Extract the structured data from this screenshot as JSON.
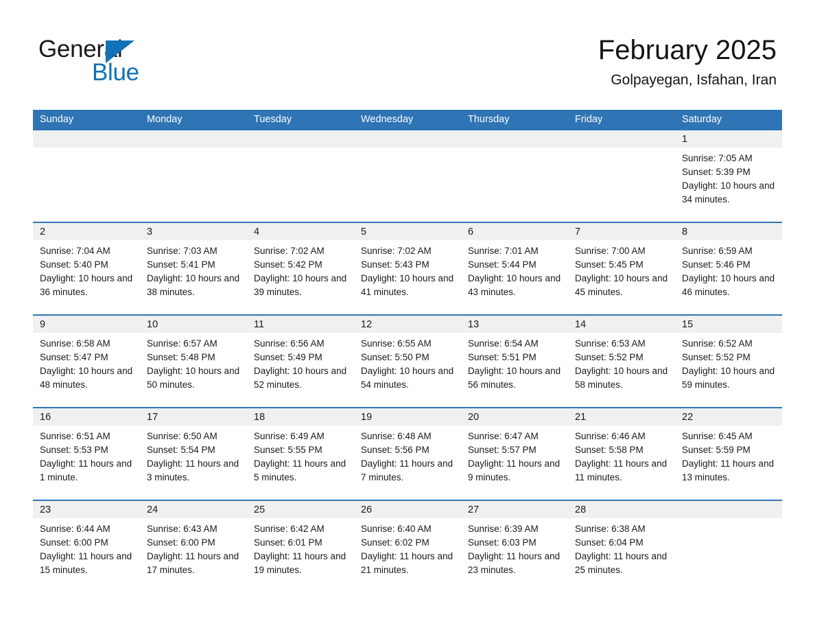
{
  "brand": {
    "name_part1": "General",
    "name_part2": "Blue",
    "accent_color": "#1271b5"
  },
  "header": {
    "title": "February 2025",
    "subtitle": "Golpayegan, Isfahan, Iran"
  },
  "calendar": {
    "header_color": "#2f74b5",
    "daynum_band_color": "#f0f0f0",
    "weekday_headers": [
      "Sunday",
      "Monday",
      "Tuesday",
      "Wednesday",
      "Thursday",
      "Friday",
      "Saturday"
    ],
    "weeks": [
      [
        {
          "day": "",
          "empty": true
        },
        {
          "day": "",
          "empty": true
        },
        {
          "day": "",
          "empty": true
        },
        {
          "day": "",
          "empty": true
        },
        {
          "day": "",
          "empty": true
        },
        {
          "day": "",
          "empty": true
        },
        {
          "day": "1",
          "sunrise": "Sunrise: 7:05 AM",
          "sunset": "Sunset: 5:39 PM",
          "daylight": "Daylight: 10 hours and 34 minutes."
        }
      ],
      [
        {
          "day": "2",
          "sunrise": "Sunrise: 7:04 AM",
          "sunset": "Sunset: 5:40 PM",
          "daylight": "Daylight: 10 hours and 36 minutes."
        },
        {
          "day": "3",
          "sunrise": "Sunrise: 7:03 AM",
          "sunset": "Sunset: 5:41 PM",
          "daylight": "Daylight: 10 hours and 38 minutes."
        },
        {
          "day": "4",
          "sunrise": "Sunrise: 7:02 AM",
          "sunset": "Sunset: 5:42 PM",
          "daylight": "Daylight: 10 hours and 39 minutes."
        },
        {
          "day": "5",
          "sunrise": "Sunrise: 7:02 AM",
          "sunset": "Sunset: 5:43 PM",
          "daylight": "Daylight: 10 hours and 41 minutes."
        },
        {
          "day": "6",
          "sunrise": "Sunrise: 7:01 AM",
          "sunset": "Sunset: 5:44 PM",
          "daylight": "Daylight: 10 hours and 43 minutes."
        },
        {
          "day": "7",
          "sunrise": "Sunrise: 7:00 AM",
          "sunset": "Sunset: 5:45 PM",
          "daylight": "Daylight: 10 hours and 45 minutes."
        },
        {
          "day": "8",
          "sunrise": "Sunrise: 6:59 AM",
          "sunset": "Sunset: 5:46 PM",
          "daylight": "Daylight: 10 hours and 46 minutes."
        }
      ],
      [
        {
          "day": "9",
          "sunrise": "Sunrise: 6:58 AM",
          "sunset": "Sunset: 5:47 PM",
          "daylight": "Daylight: 10 hours and 48 minutes."
        },
        {
          "day": "10",
          "sunrise": "Sunrise: 6:57 AM",
          "sunset": "Sunset: 5:48 PM",
          "daylight": "Daylight: 10 hours and 50 minutes."
        },
        {
          "day": "11",
          "sunrise": "Sunrise: 6:56 AM",
          "sunset": "Sunset: 5:49 PM",
          "daylight": "Daylight: 10 hours and 52 minutes."
        },
        {
          "day": "12",
          "sunrise": "Sunrise: 6:55 AM",
          "sunset": "Sunset: 5:50 PM",
          "daylight": "Daylight: 10 hours and 54 minutes."
        },
        {
          "day": "13",
          "sunrise": "Sunrise: 6:54 AM",
          "sunset": "Sunset: 5:51 PM",
          "daylight": "Daylight: 10 hours and 56 minutes."
        },
        {
          "day": "14",
          "sunrise": "Sunrise: 6:53 AM",
          "sunset": "Sunset: 5:52 PM",
          "daylight": "Daylight: 10 hours and 58 minutes."
        },
        {
          "day": "15",
          "sunrise": "Sunrise: 6:52 AM",
          "sunset": "Sunset: 5:52 PM",
          "daylight": "Daylight: 10 hours and 59 minutes."
        }
      ],
      [
        {
          "day": "16",
          "sunrise": "Sunrise: 6:51 AM",
          "sunset": "Sunset: 5:53 PM",
          "daylight": "Daylight: 11 hours and 1 minute."
        },
        {
          "day": "17",
          "sunrise": "Sunrise: 6:50 AM",
          "sunset": "Sunset: 5:54 PM",
          "daylight": "Daylight: 11 hours and 3 minutes."
        },
        {
          "day": "18",
          "sunrise": "Sunrise: 6:49 AM",
          "sunset": "Sunset: 5:55 PM",
          "daylight": "Daylight: 11 hours and 5 minutes."
        },
        {
          "day": "19",
          "sunrise": "Sunrise: 6:48 AM",
          "sunset": "Sunset: 5:56 PM",
          "daylight": "Daylight: 11 hours and 7 minutes."
        },
        {
          "day": "20",
          "sunrise": "Sunrise: 6:47 AM",
          "sunset": "Sunset: 5:57 PM",
          "daylight": "Daylight: 11 hours and 9 minutes."
        },
        {
          "day": "21",
          "sunrise": "Sunrise: 6:46 AM",
          "sunset": "Sunset: 5:58 PM",
          "daylight": "Daylight: 11 hours and 11 minutes."
        },
        {
          "day": "22",
          "sunrise": "Sunrise: 6:45 AM",
          "sunset": "Sunset: 5:59 PM",
          "daylight": "Daylight: 11 hours and 13 minutes."
        }
      ],
      [
        {
          "day": "23",
          "sunrise": "Sunrise: 6:44 AM",
          "sunset": "Sunset: 6:00 PM",
          "daylight": "Daylight: 11 hours and 15 minutes."
        },
        {
          "day": "24",
          "sunrise": "Sunrise: 6:43 AM",
          "sunset": "Sunset: 6:00 PM",
          "daylight": "Daylight: 11 hours and 17 minutes."
        },
        {
          "day": "25",
          "sunrise": "Sunrise: 6:42 AM",
          "sunset": "Sunset: 6:01 PM",
          "daylight": "Daylight: 11 hours and 19 minutes."
        },
        {
          "day": "26",
          "sunrise": "Sunrise: 6:40 AM",
          "sunset": "Sunset: 6:02 PM",
          "daylight": "Daylight: 11 hours and 21 minutes."
        },
        {
          "day": "27",
          "sunrise": "Sunrise: 6:39 AM",
          "sunset": "Sunset: 6:03 PM",
          "daylight": "Daylight: 11 hours and 23 minutes."
        },
        {
          "day": "28",
          "sunrise": "Sunrise: 6:38 AM",
          "sunset": "Sunset: 6:04 PM",
          "daylight": "Daylight: 11 hours and 25 minutes."
        },
        {
          "day": "",
          "empty": true
        }
      ]
    ]
  }
}
